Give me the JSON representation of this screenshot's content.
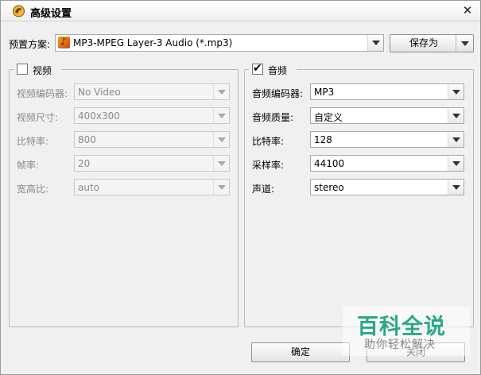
{
  "window": {
    "title": "高级设置",
    "close_glyph": "✕"
  },
  "preset": {
    "label": "预置方案:",
    "value": "MP3-MPEG Layer-3 Audio (*.mp3)",
    "icon": "mp3-audio-icon"
  },
  "save_as": {
    "label": "保存为"
  },
  "video": {
    "title": "视频",
    "enabled": false,
    "fields": [
      {
        "label": "视频编码器:",
        "value": "No Video"
      },
      {
        "label": "视频尺寸:",
        "value": "400x300"
      },
      {
        "label": "比特率:",
        "value": "800"
      },
      {
        "label": "帧率:",
        "value": "20"
      },
      {
        "label": "宽高比:",
        "value": "auto"
      }
    ]
  },
  "audio": {
    "title": "音频",
    "enabled": true,
    "fields": [
      {
        "label": "音频编码器:",
        "value": "MP3"
      },
      {
        "label": "音频质量:",
        "value": "自定义"
      },
      {
        "label": "比特率:",
        "value": "128"
      },
      {
        "label": "采样率:",
        "value": "44100"
      },
      {
        "label": "声道:",
        "value": "stereo"
      }
    ]
  },
  "footer": {
    "ok_label": "确定",
    "cancel_label": "关闭"
  },
  "watermark": {
    "main": "百科全说",
    "sub": "助你轻松解决"
  }
}
